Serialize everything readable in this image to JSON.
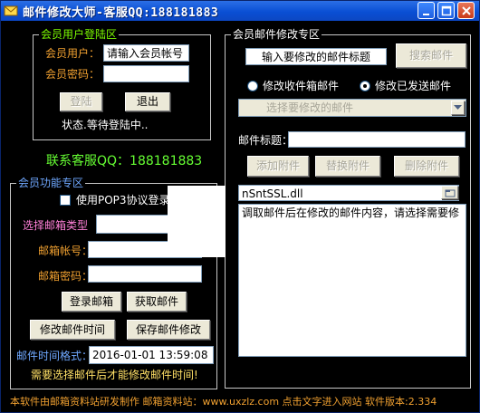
{
  "window": {
    "title": "邮件修改大师-客服QQ:188181883",
    "colors": {
      "titlebar": "#0a4fd4",
      "background": "#000000",
      "legend_green": "#7cfc00",
      "legend_blue": "#6fa8ff",
      "label_orange": "#f0a030",
      "label_pink": "#ff80d8",
      "qq_green": "#66ff33",
      "status_white": "#ffffff",
      "yellow_tip": "#ffe066",
      "footer_text": "#f0a030"
    }
  },
  "login": {
    "legend": "会员用户登陆区",
    "user_label": "会员用户：",
    "user_value": "请输入会员帐号",
    "password_label": "会员密码：",
    "password_value": "",
    "login_button": "登陆",
    "quit_button": "退出",
    "status": "状态.等待登陆中.."
  },
  "service": {
    "qq_text": "联系客服QQ：188181883"
  },
  "member": {
    "legend": "会员功能专区",
    "pop3_checkbox_label": "使用POP3协议登录",
    "pop3_checked": false,
    "mailbox_type_label": "选择邮箱类型",
    "mailbox_type_value": "",
    "account_label": "邮箱帐号：",
    "account_value": "",
    "password_label": "邮箱密码：",
    "password_value": "",
    "login_mail_button": "登录邮箱",
    "fetch_mail_button": "获取邮件",
    "modify_time_button": "修改邮件时间",
    "save_button": "保存邮件修改",
    "time_format_label": "邮件时间格式：",
    "time_value": "2016-01-01 13:59:08",
    "tip": "需要选择邮件后才能修改邮件时间!"
  },
  "edit": {
    "legend": "会员邮件修改专区",
    "search_input": "输入要修改的邮件标题",
    "search_button": "搜索邮件",
    "radio_inbox": "修改收件箱邮件",
    "radio_sent": "修改已发送邮件",
    "mail_select_placeholder": "选择要修改的邮件",
    "subject_label": "邮件标题：",
    "subject_value": "",
    "add_attach_button": "添加附件",
    "replace_attach_button": "替换附件",
    "delete_attach_button": "删除附件",
    "attachment_value": "nSntSSL.dll",
    "body_text": "调取邮件后在修改的邮件内容，请选择需要修"
  },
  "footer": {
    "text": "本软件由邮箱资料站研发制作 邮箱资料站：www.uxzlz.com 点击文字进入网站 软件版本:2.334"
  }
}
